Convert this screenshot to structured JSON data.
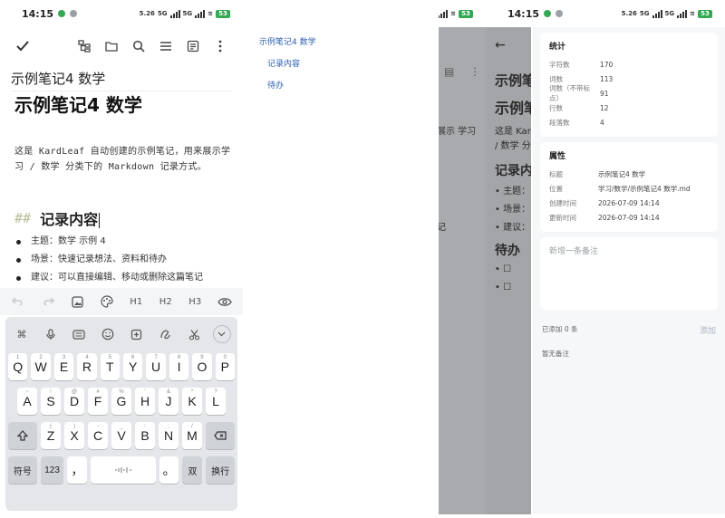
{
  "status": {
    "time": "14:15",
    "net": "5.26",
    "g1": "5G",
    "g2": "5G",
    "battery": "53"
  },
  "editor": {
    "title": "示例笔记4 数学",
    "h1": "示例笔记4 数学",
    "intro": "这是 KardLeaf 自动创建的示例笔记，用来展示学习 / 数学 分类下的 Markdown 记录方式。",
    "h2_marker": "##",
    "h2": "记录内容",
    "bullets": [
      "主题：数学 示例 4",
      "场景：快速记录想法、资料和待办",
      "建议：可以直接编辑、移动或删除这篇笔记"
    ],
    "format_bar": {
      "h1": "H1",
      "h2": "H2",
      "h3": "H3"
    }
  },
  "keyboard": {
    "row1": [
      {
        "k": "Q",
        "s": "1"
      },
      {
        "k": "W",
        "s": "2"
      },
      {
        "k": "E",
        "s": "3"
      },
      {
        "k": "R",
        "s": "4"
      },
      {
        "k": "T",
        "s": "5"
      },
      {
        "k": "Y",
        "s": "6"
      },
      {
        "k": "U",
        "s": "7"
      },
      {
        "k": "I",
        "s": "8"
      },
      {
        "k": "O",
        "s": "9"
      },
      {
        "k": "P",
        "s": "0"
      }
    ],
    "row2": [
      {
        "k": "A",
        "s": "~"
      },
      {
        "k": "S",
        "s": "!"
      },
      {
        "k": "D",
        "s": "@"
      },
      {
        "k": "F",
        "s": "#"
      },
      {
        "k": "G",
        "s": "%"
      },
      {
        "k": "H",
        "s": "'"
      },
      {
        "k": "J",
        "s": "&"
      },
      {
        "k": "K",
        "s": "*"
      },
      {
        "k": "L",
        "s": "?"
      }
    ],
    "row3": [
      {
        "k": "Z",
        "s": "("
      },
      {
        "k": "X",
        "s": ")"
      },
      {
        "k": "C",
        "s": "-"
      },
      {
        "k": "V",
        "s": "_"
      },
      {
        "k": "B",
        "s": ":"
      },
      {
        "k": "N",
        "s": ";"
      },
      {
        "k": "M",
        "s": "/"
      }
    ],
    "symbol_key": "符号",
    "num_key": "123",
    "comma_key": "，",
    "period_key": "。",
    "lang_key": "双",
    "enter_key": "换行"
  },
  "drawer": {
    "items": [
      "示例笔记4 数学",
      "记录内容",
      "待办"
    ],
    "bg_lines": [
      "展示 学习",
      "记"
    ]
  },
  "details": {
    "bg_lines": [
      "示例笔",
      "示例笔",
      "这是 Kar",
      "/ 数学 分",
      "记录内",
      "• 主题：",
      "• 场景：",
      "• 建议：",
      "待办"
    ],
    "stats": {
      "title": "统计",
      "rows": [
        {
          "k": "字符数",
          "v": "170"
        },
        {
          "k": "词数",
          "v": "113"
        },
        {
          "k": "词数（不带标点）",
          "v": "91"
        },
        {
          "k": "行数",
          "v": "12"
        },
        {
          "k": "段落数",
          "v": "4"
        }
      ]
    },
    "props": {
      "title": "属性",
      "rows": [
        {
          "k": "标题",
          "v": "示例笔记4 数学"
        },
        {
          "k": "位置",
          "v": "学习/数学/示例笔记4 数学.md"
        },
        {
          "k": "创建时间",
          "v": "2026-07-09 14:14"
        },
        {
          "k": "更新时间",
          "v": "2026-07-09 14:14"
        }
      ]
    },
    "note_placeholder": "新增一条备注",
    "added_count": "已添加 0 条",
    "add_label": "添加",
    "empty_label": "暂无备注"
  }
}
